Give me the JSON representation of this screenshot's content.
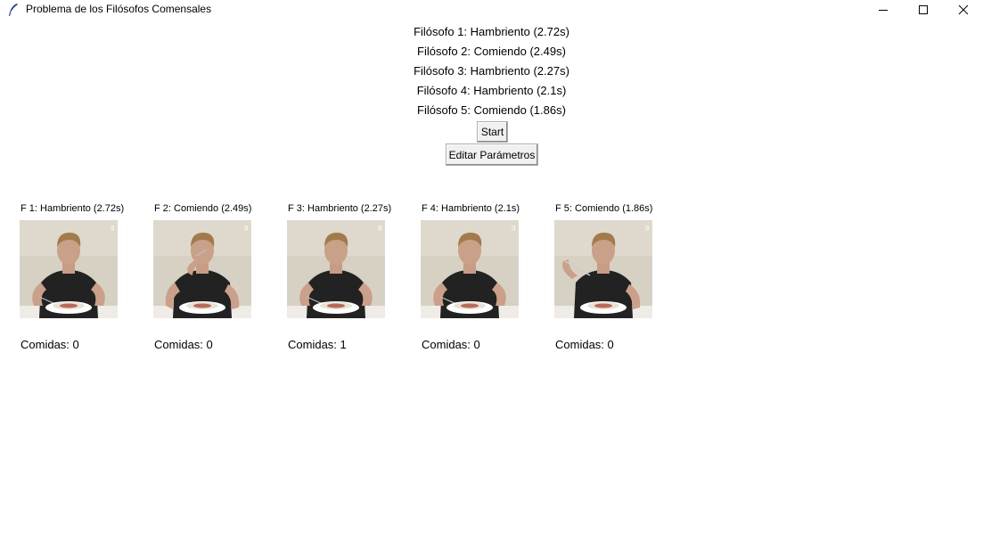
{
  "window": {
    "title": "Problema de los Filósofos Comensales",
    "icon": "feather-icon",
    "controls": [
      "minimize-icon",
      "maximize-icon",
      "close-icon"
    ]
  },
  "status_lines": [
    "Filósofo 1: Hambriento (2.72s)",
    "Filósofo 2: Comiendo (2.49s)",
    "Filósofo 3: Hambriento (2.27s)",
    "Filósofo 4: Hambriento (2.1s)",
    "Filósofo 5: Comiendo (1.86s)"
  ],
  "buttons": {
    "start": "Start",
    "edit": "Editar Parámetros"
  },
  "philosophers": [
    {
      "label": "F 1: Hambriento (2.72s)",
      "meals": "Comidas: 0",
      "state": "waiting"
    },
    {
      "label": "F 2: Comiendo (2.49s)",
      "meals": "Comidas: 0",
      "state": "eating"
    },
    {
      "label": "F 3: Hambriento (2.27s)",
      "meals": "Comidas: 1",
      "state": "waiting"
    },
    {
      "label": "F 4: Hambriento (2.1s)",
      "meals": "Comidas: 0",
      "state": "waiting"
    },
    {
      "label": "F 5: Comiendo (1.86s)",
      "meals": "Comidas: 0",
      "state": "eating"
    }
  ]
}
